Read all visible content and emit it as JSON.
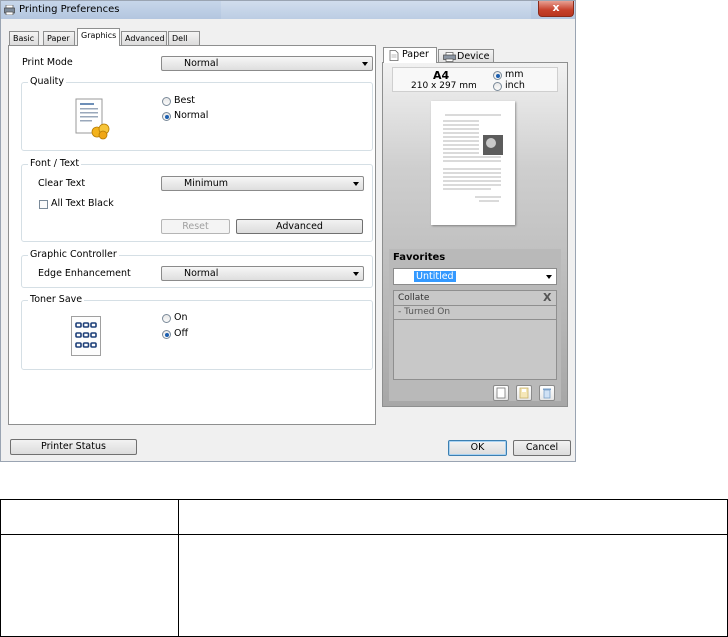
{
  "window": {
    "title": "Printing Preferences",
    "close_label": "x"
  },
  "tabs": [
    {
      "label": "Basic"
    },
    {
      "label": "Paper"
    },
    {
      "label": "Graphics"
    },
    {
      "label": "Advanced"
    },
    {
      "label": "Dell"
    }
  ],
  "graphics": {
    "print_mode_label": "Print Mode",
    "print_mode_value": "Normal",
    "quality": {
      "group_label": "Quality",
      "options": [
        "Best",
        "Normal"
      ],
      "selected": "Normal"
    },
    "font_text": {
      "group_label": "Font / Text",
      "clear_text_label": "Clear Text",
      "clear_text_value": "Minimum",
      "all_text_black_label": "All Text Black",
      "all_text_black_checked": false,
      "reset_label": "Reset",
      "advanced_label": "Advanced"
    },
    "graphic_controller": {
      "group_label": "Graphic Controller",
      "edge_label": "Edge Enhancement",
      "edge_value": "Normal"
    },
    "toner_save": {
      "group_label": "Toner Save",
      "options": [
        "On",
        "Off"
      ],
      "selected": "Off"
    }
  },
  "preview": {
    "tabs": [
      {
        "label": "Paper"
      },
      {
        "label": "Device"
      }
    ],
    "paper_size": "A4",
    "paper_dims": "210 x 297 mm",
    "units": [
      "mm",
      "inch"
    ],
    "selected_unit": "mm"
  },
  "favorites": {
    "title": "Favorites",
    "value": "Untitled",
    "item_title": "Collate",
    "item_detail": "- Turned On",
    "remove_label": "X"
  },
  "footer": {
    "printer_status_label": "Printer Status",
    "ok_label": "OK",
    "cancel_label": "Cancel"
  }
}
